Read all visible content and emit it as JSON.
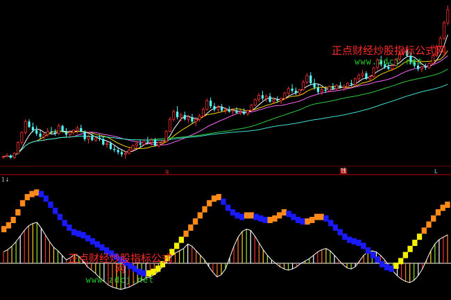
{
  "chart_data": {
    "type": "candlestick",
    "title": "",
    "xlabel": "",
    "ylabel": "",
    "grid": false,
    "candles": [
      [
        0.52,
        0.53,
        0.5,
        0.52
      ],
      [
        0.52,
        0.55,
        0.51,
        0.53
      ],
      [
        0.53,
        0.54,
        0.5,
        0.51
      ],
      [
        0.51,
        0.56,
        0.5,
        0.55
      ],
      [
        0.55,
        0.66,
        0.54,
        0.65
      ],
      [
        0.65,
        0.75,
        0.63,
        0.74
      ],
      [
        0.74,
        0.86,
        0.72,
        0.84
      ],
      [
        0.84,
        0.86,
        0.78,
        0.79
      ],
      [
        0.79,
        0.83,
        0.74,
        0.76
      ],
      [
        0.76,
        0.8,
        0.71,
        0.73
      ],
      [
        0.73,
        0.76,
        0.68,
        0.7
      ],
      [
        0.7,
        0.74,
        0.66,
        0.72
      ],
      [
        0.72,
        0.78,
        0.7,
        0.75
      ],
      [
        0.75,
        0.79,
        0.72,
        0.74
      ],
      [
        0.74,
        0.77,
        0.71,
        0.73
      ],
      [
        0.73,
        0.82,
        0.72,
        0.8
      ],
      [
        0.8,
        0.81,
        0.74,
        0.75
      ],
      [
        0.75,
        0.78,
        0.7,
        0.72
      ],
      [
        0.72,
        0.76,
        0.69,
        0.74
      ],
      [
        0.74,
        0.77,
        0.72,
        0.76
      ],
      [
        0.76,
        0.8,
        0.73,
        0.78
      ],
      [
        0.78,
        0.81,
        0.74,
        0.75
      ],
      [
        0.75,
        0.76,
        0.66,
        0.68
      ],
      [
        0.68,
        0.72,
        0.64,
        0.7
      ],
      [
        0.7,
        0.73,
        0.66,
        0.67
      ],
      [
        0.67,
        0.71,
        0.65,
        0.69
      ],
      [
        0.69,
        0.72,
        0.66,
        0.68
      ],
      [
        0.68,
        0.7,
        0.62,
        0.63
      ],
      [
        0.63,
        0.66,
        0.6,
        0.64
      ],
      [
        0.64,
        0.66,
        0.58,
        0.59
      ],
      [
        0.59,
        0.62,
        0.56,
        0.58
      ],
      [
        0.58,
        0.6,
        0.54,
        0.56
      ],
      [
        0.56,
        0.58,
        0.52,
        0.54
      ],
      [
        0.54,
        0.57,
        0.5,
        0.55
      ],
      [
        0.55,
        0.6,
        0.54,
        0.58
      ],
      [
        0.58,
        0.63,
        0.57,
        0.62
      ],
      [
        0.62,
        0.66,
        0.6,
        0.64
      ],
      [
        0.64,
        0.67,
        0.61,
        0.63
      ],
      [
        0.63,
        0.68,
        0.62,
        0.66
      ],
      [
        0.66,
        0.7,
        0.63,
        0.65
      ],
      [
        0.65,
        0.69,
        0.62,
        0.67
      ],
      [
        0.67,
        0.69,
        0.61,
        0.62
      ],
      [
        0.62,
        0.66,
        0.6,
        0.65
      ],
      [
        0.65,
        0.67,
        0.63,
        0.66
      ],
      [
        0.66,
        0.76,
        0.65,
        0.75
      ],
      [
        0.75,
        0.88,
        0.74,
        0.86
      ],
      [
        0.86,
        0.95,
        0.84,
        0.93
      ],
      [
        0.93,
        0.98,
        0.86,
        0.88
      ],
      [
        0.88,
        0.92,
        0.84,
        0.9
      ],
      [
        0.9,
        0.93,
        0.85,
        0.86
      ],
      [
        0.86,
        0.9,
        0.83,
        0.88
      ],
      [
        0.88,
        0.91,
        0.82,
        0.84
      ],
      [
        0.84,
        0.88,
        0.8,
        0.86
      ],
      [
        0.86,
        0.91,
        0.84,
        0.89
      ],
      [
        0.89,
        0.97,
        0.88,
        0.95
      ],
      [
        0.95,
        1.05,
        0.94,
        1.03
      ],
      [
        1.03,
        1.06,
        0.96,
        0.98
      ],
      [
        0.98,
        1.01,
        0.93,
        0.95
      ],
      [
        0.95,
        0.99,
        0.92,
        0.97
      ],
      [
        0.97,
        1.0,
        0.93,
        0.94
      ],
      [
        0.94,
        0.97,
        0.91,
        0.95
      ],
      [
        0.95,
        0.98,
        0.92,
        0.93
      ],
      [
        0.93,
        0.96,
        0.9,
        0.94
      ],
      [
        0.94,
        0.97,
        0.91,
        0.92
      ],
      [
        0.92,
        0.95,
        0.9,
        0.93
      ],
      [
        0.93,
        0.96,
        0.9,
        0.91
      ],
      [
        0.91,
        0.95,
        0.89,
        0.94
      ],
      [
        0.94,
        1.0,
        0.93,
        0.99
      ],
      [
        0.99,
        1.05,
        0.98,
        1.04
      ],
      [
        1.04,
        1.1,
        1.02,
        1.08
      ],
      [
        1.08,
        1.12,
        1.03,
        1.05
      ],
      [
        1.05,
        1.09,
        1.02,
        1.07
      ],
      [
        1.07,
        1.1,
        1.01,
        1.02
      ],
      [
        1.02,
        1.06,
        1.0,
        1.04
      ],
      [
        1.04,
        1.07,
        1.01,
        1.03
      ],
      [
        1.03,
        1.06,
        1.0,
        1.05
      ],
      [
        1.05,
        1.11,
        1.04,
        1.1
      ],
      [
        1.1,
        1.16,
        1.08,
        1.14
      ],
      [
        1.14,
        1.18,
        1.1,
        1.12
      ],
      [
        1.12,
        1.15,
        1.08,
        1.1
      ],
      [
        1.1,
        1.14,
        1.07,
        1.13
      ],
      [
        1.13,
        1.22,
        1.12,
        1.2
      ],
      [
        1.2,
        1.28,
        1.18,
        1.26
      ],
      [
        1.26,
        1.29,
        1.17,
        1.19
      ],
      [
        1.19,
        1.23,
        1.13,
        1.15
      ],
      [
        1.15,
        1.18,
        1.09,
        1.11
      ],
      [
        1.11,
        1.15,
        1.08,
        1.13
      ],
      [
        1.13,
        1.16,
        1.1,
        1.12
      ],
      [
        1.12,
        1.17,
        1.11,
        1.16
      ],
      [
        1.16,
        1.19,
        1.13,
        1.14
      ],
      [
        1.14,
        1.18,
        1.12,
        1.17
      ],
      [
        1.17,
        1.2,
        1.14,
        1.15
      ],
      [
        1.15,
        1.18,
        1.12,
        1.16
      ],
      [
        1.16,
        1.2,
        1.15,
        1.19
      ],
      [
        1.19,
        1.22,
        1.16,
        1.18
      ],
      [
        1.18,
        1.24,
        1.17,
        1.23
      ],
      [
        1.23,
        1.28,
        1.21,
        1.26
      ],
      [
        1.26,
        1.31,
        1.24,
        1.28
      ],
      [
        1.28,
        1.3,
        1.22,
        1.23
      ],
      [
        1.23,
        1.26,
        1.2,
        1.25
      ],
      [
        1.25,
        1.34,
        1.24,
        1.33
      ],
      [
        1.33,
        1.42,
        1.31,
        1.4
      ],
      [
        1.4,
        1.44,
        1.34,
        1.36
      ],
      [
        1.36,
        1.39,
        1.32,
        1.34
      ],
      [
        1.34,
        1.38,
        1.31,
        1.32
      ],
      [
        1.32,
        1.36,
        1.3,
        1.35
      ],
      [
        1.35,
        1.42,
        1.34,
        1.41
      ],
      [
        1.41,
        1.48,
        1.39,
        1.46
      ],
      [
        1.46,
        1.52,
        1.44,
        1.5
      ],
      [
        1.5,
        1.53,
        1.43,
        1.44
      ],
      [
        1.44,
        1.47,
        1.36,
        1.38
      ],
      [
        1.38,
        1.41,
        1.33,
        1.35
      ],
      [
        1.35,
        1.38,
        1.3,
        1.32
      ],
      [
        1.32,
        1.35,
        1.29,
        1.34
      ],
      [
        1.34,
        1.37,
        1.31,
        1.33
      ],
      [
        1.33,
        1.38,
        1.32,
        1.37
      ],
      [
        1.37,
        1.45,
        1.36,
        1.44
      ],
      [
        1.44,
        1.54,
        1.43,
        1.52
      ],
      [
        1.52,
        1.62,
        1.5,
        1.6
      ],
      [
        1.6,
        1.76,
        1.58,
        1.74
      ],
      [
        1.74,
        1.9,
        1.72,
        1.86
      ]
    ],
    "oscillator_values": [
      0.2,
      0.24,
      0.3,
      0.38,
      0.48,
      0.58,
      0.66,
      0.7,
      0.72,
      0.62,
      0.5,
      0.38,
      0.28,
      0.22,
      0.14,
      0.06,
      0.1,
      0.16,
      0.12,
      0.04,
      -0.06,
      -0.12,
      -0.18,
      -0.26,
      -0.32,
      -0.38,
      -0.42,
      -0.44,
      -0.46,
      -0.44,
      -0.42,
      -0.38,
      -0.34,
      -0.3,
      -0.26,
      -0.24,
      -0.2,
      -0.14,
      -0.06,
      0.04,
      0.12,
      0.18,
      0.22,
      0.26,
      0.34,
      0.3,
      0.22,
      0.14,
      0.06,
      -0.06,
      -0.16,
      -0.24,
      -0.2,
      -0.1,
      0.1,
      0.3,
      0.46,
      0.56,
      0.6,
      0.58,
      0.48,
      0.36,
      0.24,
      0.14,
      0.06,
      0.0,
      -0.06,
      -0.1,
      -0.12,
      -0.1,
      -0.06,
      0.0,
      0.04,
      0.08,
      0.14,
      0.2,
      0.24,
      0.26,
      0.22,
      0.14,
      0.06,
      -0.02,
      -0.08,
      -0.1,
      -0.06,
      0.04,
      0.14,
      0.2,
      0.22,
      0.2,
      0.14,
      0.06,
      -0.04,
      -0.14,
      -0.22,
      -0.28,
      -0.32,
      -0.34,
      -0.3,
      -0.22,
      -0.1,
      0.06,
      0.22,
      0.34,
      0.42,
      0.46,
      0.5
    ],
    "oscillator_signal_values": [
      0.18,
      0.23,
      0.3,
      0.4,
      0.52,
      0.6,
      0.64,
      0.66,
      0.64,
      0.58,
      0.5,
      0.42,
      0.34,
      0.26,
      0.2,
      0.14,
      0.12,
      0.1,
      0.06,
      0.02,
      -0.02,
      -0.06,
      -0.1,
      -0.14,
      -0.18,
      -0.22,
      -0.26,
      -0.3,
      -0.34,
      -0.38,
      -0.4,
      -0.4,
      -0.38,
      -0.34,
      -0.28,
      -0.2,
      -0.12,
      -0.04,
      0.04,
      0.12,
      0.2,
      0.28,
      0.36,
      0.44,
      0.52,
      0.58,
      0.6,
      0.54,
      0.46,
      0.4,
      0.36,
      0.34,
      0.36,
      0.36,
      0.34,
      0.32,
      0.3,
      0.3,
      0.32,
      0.36,
      0.4,
      0.38,
      0.34,
      0.3,
      0.28,
      0.28,
      0.3,
      0.34,
      0.34,
      0.32,
      0.26,
      0.2,
      0.14,
      0.08,
      0.04,
      0.02,
      0.0,
      -0.04,
      -0.1,
      -0.16,
      -0.22,
      -0.28,
      -0.32,
      -0.34,
      -0.3,
      -0.24,
      -0.16,
      -0.08,
      0.0,
      0.08,
      0.16,
      0.24,
      0.32,
      0.4,
      0.46,
      0.5
    ],
    "trend_colors": {
      "rising": "#f5f000",
      "high": "#ff8a1a",
      "falling": "#1a1aff",
      "turn": "#22cc22"
    }
  },
  "watermarks": [
    {
      "chinese": "正点财经炒股指标公式网",
      "url": "www.zdcj.net"
    },
    {
      "chinese": "正点财经炒股指标公式网",
      "url": "www.zdcj.net"
    }
  ],
  "panel_markers": {
    "axis_label": "1↓",
    "marker_q": "q",
    "marker_box": "钱",
    "marker_l": "L"
  },
  "colors": {
    "background": "#000000",
    "up": "#ff3030",
    "down": "#54ffff",
    "ma_white": "#ffffff",
    "ma_yellow": "#ffd700",
    "ma_magenta": "#ff66ff",
    "ma_green": "#2ecc40",
    "ma_cyan": "#40e0d0",
    "axis_red": "#c00000",
    "grid_red": "#6b0000"
  }
}
